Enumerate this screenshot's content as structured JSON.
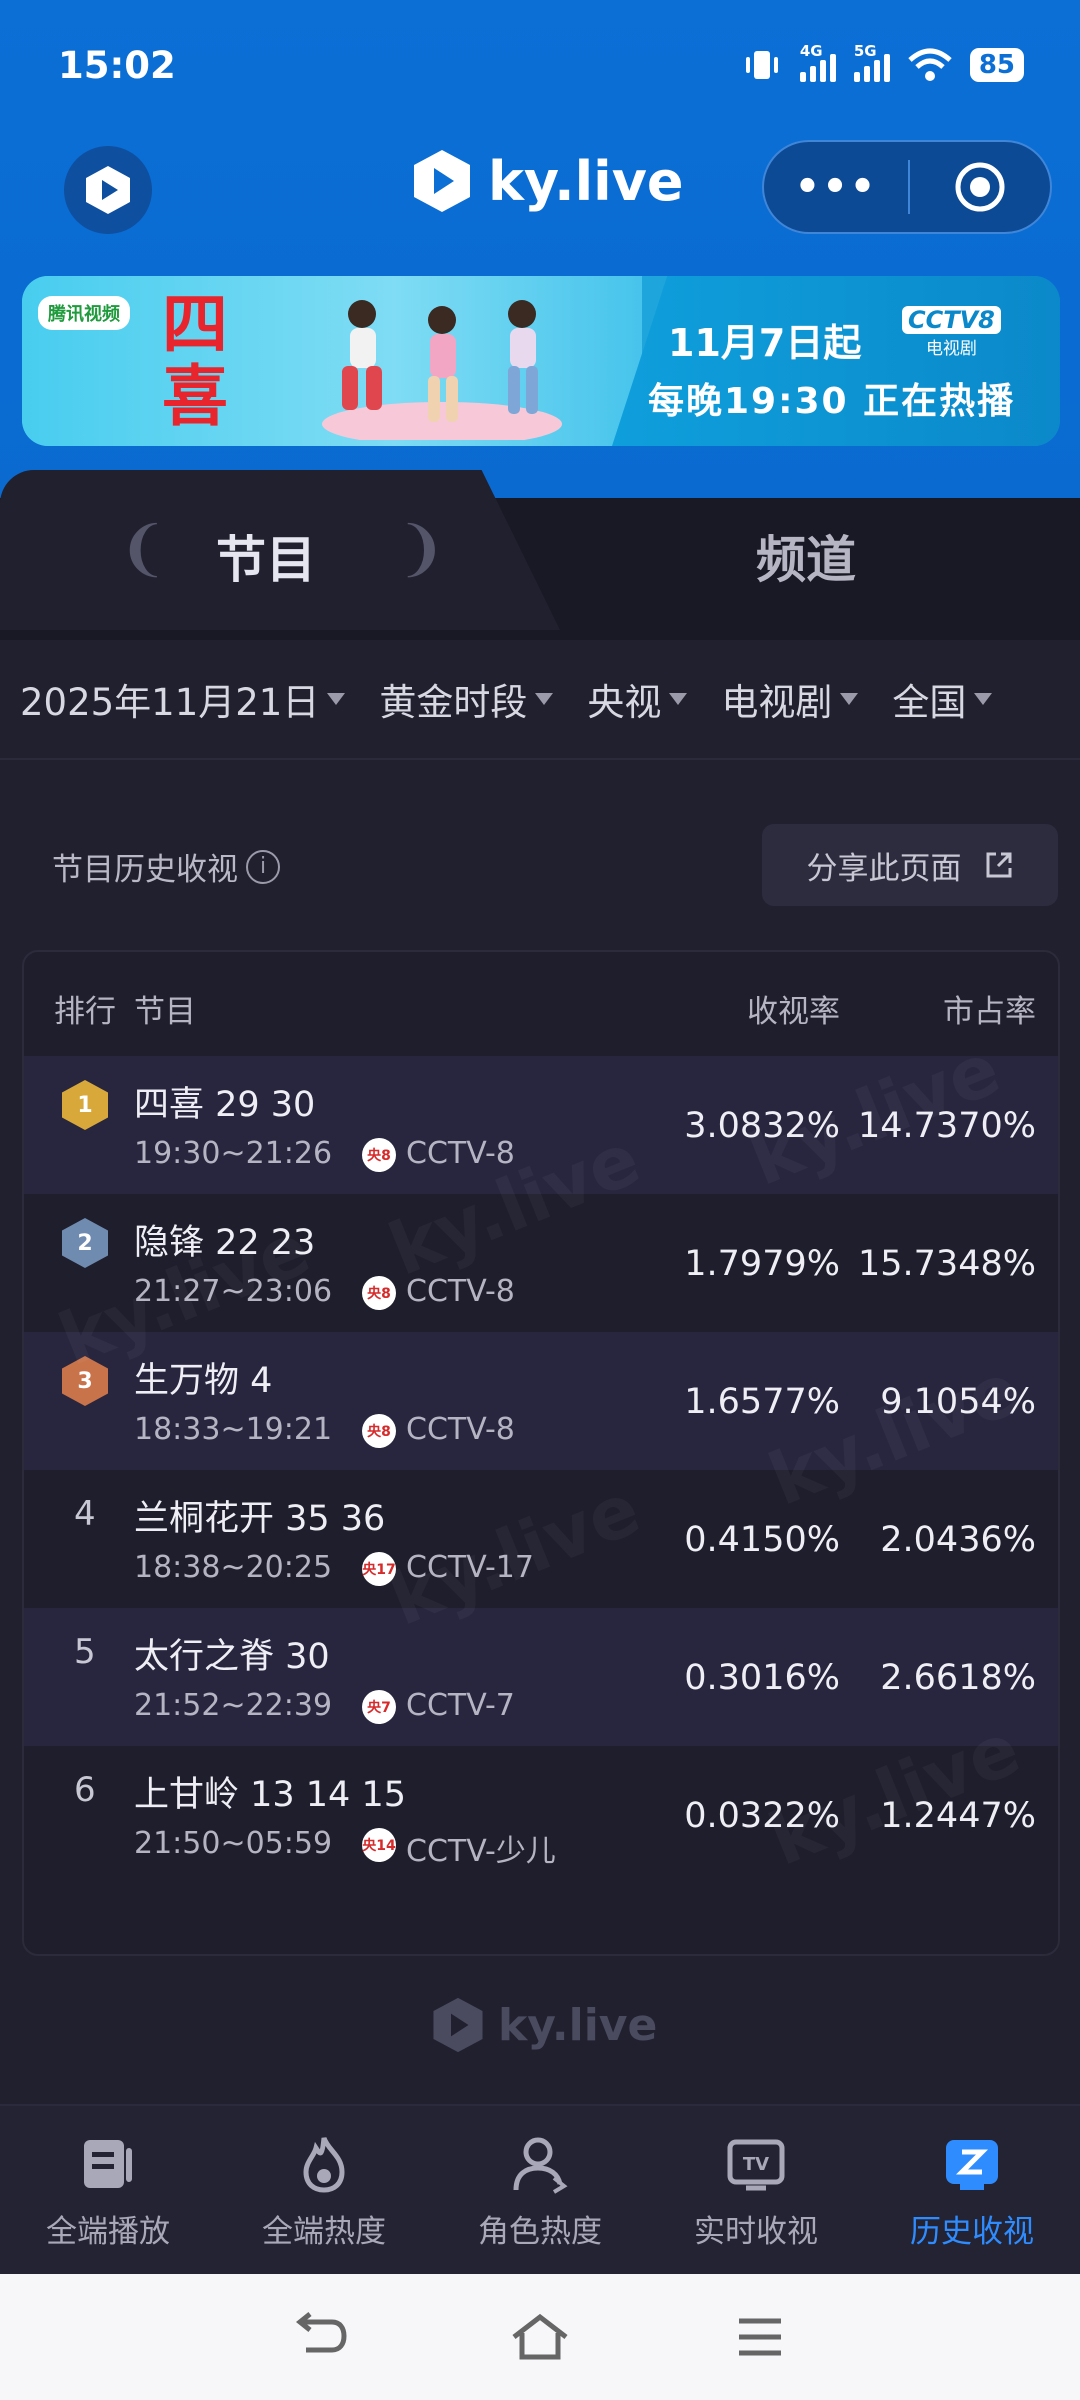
{
  "status_bar": {
    "time": "15:02",
    "net1": "4G",
    "net2": "5G",
    "battery": "85"
  },
  "header": {
    "brand": "ky.live",
    "more_label": "•••"
  },
  "banner": {
    "platform": "腾讯视频",
    "show_title": "四喜",
    "line1": "11月7日起",
    "channel_logo": "CCTV8",
    "channel_sub": "电视剧",
    "line2": "每晚19:30 正在热播"
  },
  "tabs": [
    {
      "label": "节目",
      "active": true
    },
    {
      "label": "频道",
      "active": false
    }
  ],
  "filters": [
    {
      "label": "2025年11月21日"
    },
    {
      "label": "黄金时段"
    },
    {
      "label": "央视"
    },
    {
      "label": "电视剧"
    },
    {
      "label": "全国"
    }
  ],
  "section": {
    "title": "节目历史收视",
    "share_label": "分享此页面"
  },
  "table": {
    "headers": {
      "rank": "排行",
      "program": "节目",
      "rating": "收视率",
      "share": "市占率"
    },
    "rows": [
      {
        "rank": "1",
        "name": "四喜 29 30",
        "time": "19:30~21:26",
        "channel_badge": "央8",
        "channel": "CCTV-8",
        "rating": "3.0832%",
        "share": "14.7370%",
        "medal": "gold"
      },
      {
        "rank": "2",
        "name": "隐锋 22 23",
        "time": "21:27~23:06",
        "channel_badge": "央8",
        "channel": "CCTV-8",
        "rating": "1.7979%",
        "share": "15.7348%",
        "medal": "silver"
      },
      {
        "rank": "3",
        "name": "生万物 4",
        "time": "18:33~19:21",
        "channel_badge": "央8",
        "channel": "CCTV-8",
        "rating": "1.6577%",
        "share": "9.1054%",
        "medal": "bronze"
      },
      {
        "rank": "4",
        "name": "兰桐花开 35 36",
        "time": "18:38~20:25",
        "channel_badge": "央17",
        "channel": "CCTV-17",
        "rating": "0.4150%",
        "share": "2.0436%",
        "medal": ""
      },
      {
        "rank": "5",
        "name": "太行之脊 30",
        "time": "21:52~22:39",
        "channel_badge": "央7",
        "channel": "CCTV-7",
        "rating": "0.3016%",
        "share": "2.6618%",
        "medal": ""
      },
      {
        "rank": "6",
        "name": "上甘岭 13 14 15",
        "time": "21:50~05:59",
        "channel_badge": "央14",
        "channel": "CCTV-少儿",
        "rating": "0.0322%",
        "share": "1.2447%",
        "medal": ""
      }
    ]
  },
  "footer": {
    "brand": "ky.live"
  },
  "bottom_nav": [
    {
      "label": "全端播放",
      "icon": "play-card-icon",
      "active": false
    },
    {
      "label": "全端热度",
      "icon": "flame-icon",
      "active": false
    },
    {
      "label": "角色热度",
      "icon": "person-icon",
      "active": false
    },
    {
      "label": "实时收视",
      "icon": "tv-icon",
      "active": false
    },
    {
      "label": "历史收视",
      "icon": "history-icon",
      "active": true
    }
  ],
  "colors": {
    "brand_blue": "#0b6fd6",
    "background": "#20202f",
    "active_nav": "#2f8cff",
    "gold": "#d8a93a",
    "silver": "#6f8bb0",
    "bronze": "#c8734a"
  }
}
